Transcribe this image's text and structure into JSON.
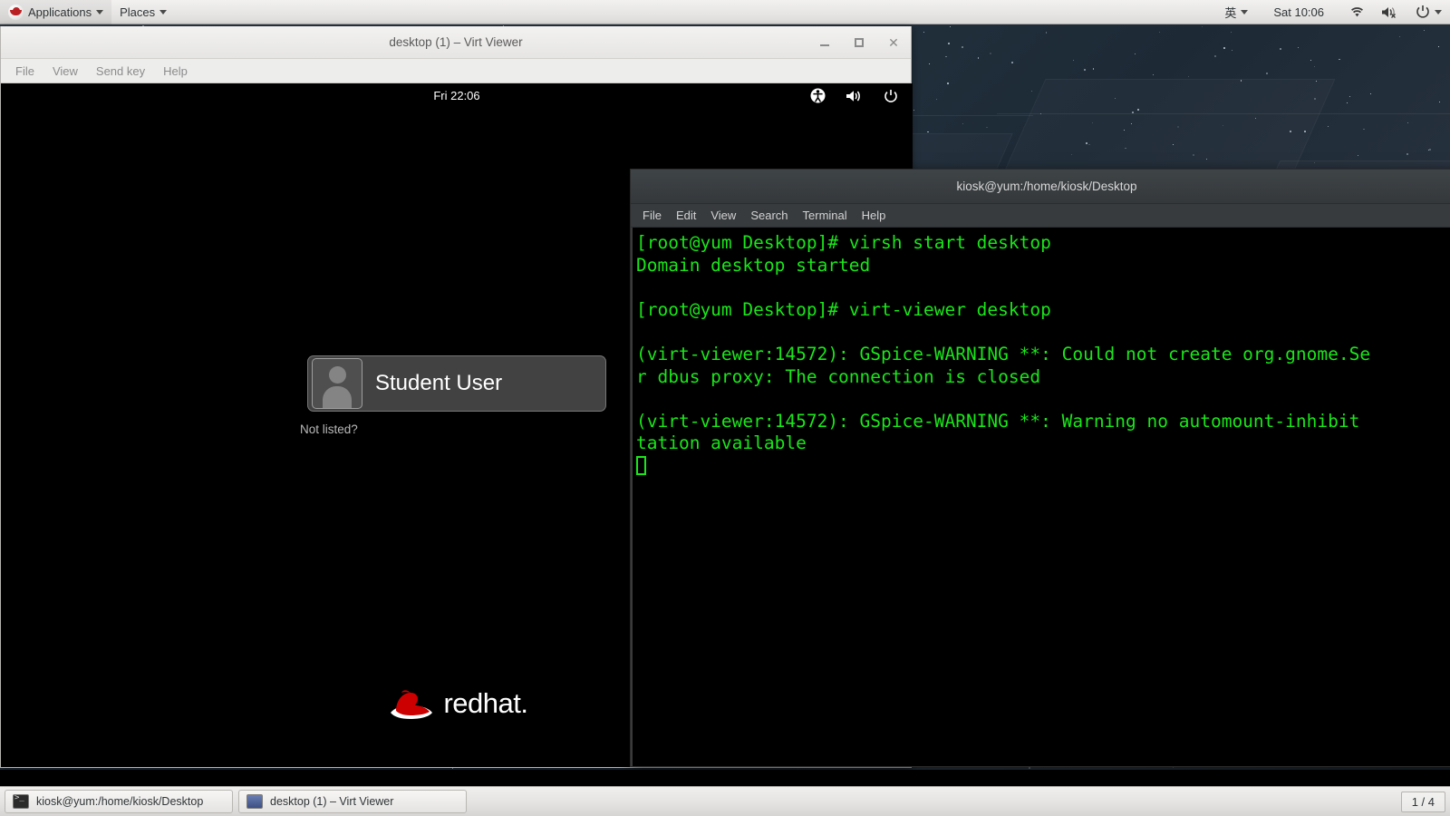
{
  "top_panel": {
    "applications_label": "Applications",
    "places_label": "Places",
    "ime_label": "英",
    "clock": "Sat 10:06",
    "icons": [
      "wifi-icon",
      "volume-muted-icon",
      "power-icon",
      "chevron-down-icon"
    ]
  },
  "virt_viewer": {
    "title": "desktop (1) – Virt Viewer",
    "menus": [
      "File",
      "View",
      "Send key",
      "Help"
    ],
    "window_controls": {
      "minimize": "–",
      "maximize": "□",
      "close": "×"
    }
  },
  "gdm": {
    "clock": "Fri 22:06",
    "icons": [
      "accessibility-icon",
      "volume-icon",
      "power-icon"
    ],
    "user": {
      "name": "Student User",
      "avatar": "generic-user-avatar"
    },
    "not_listed_label": "Not listed?",
    "brand": {
      "red": "red",
      "dark": "hat",
      "suffix": "."
    }
  },
  "terminal": {
    "title": "kiosk@yum:/home/kiosk/Desktop",
    "menus": [
      "File",
      "Edit",
      "View",
      "Search",
      "Terminal",
      "Help"
    ],
    "output": "[root@yum Desktop]# virsh start desktop\nDomain desktop started\n\n[root@yum Desktop]# virt-viewer desktop\n\n(virt-viewer:14572): GSpice-WARNING **: Could not create org.gnome.Se\nr dbus proxy: The connection is closed\n\n(virt-viewer:14572): GSpice-WARNING **: Warning no automount-inhibit\ntation available",
    "text_color": "#1ae61a",
    "background_color": "#000000"
  },
  "taskbar": {
    "windows": [
      {
        "title": "kiosk@yum:/home/kiosk/Desktop",
        "icon": "terminal-icon"
      },
      {
        "title": "desktop (1) – Virt Viewer",
        "icon": "display-icon"
      }
    ],
    "workspace_indicator": "1 / 4"
  }
}
